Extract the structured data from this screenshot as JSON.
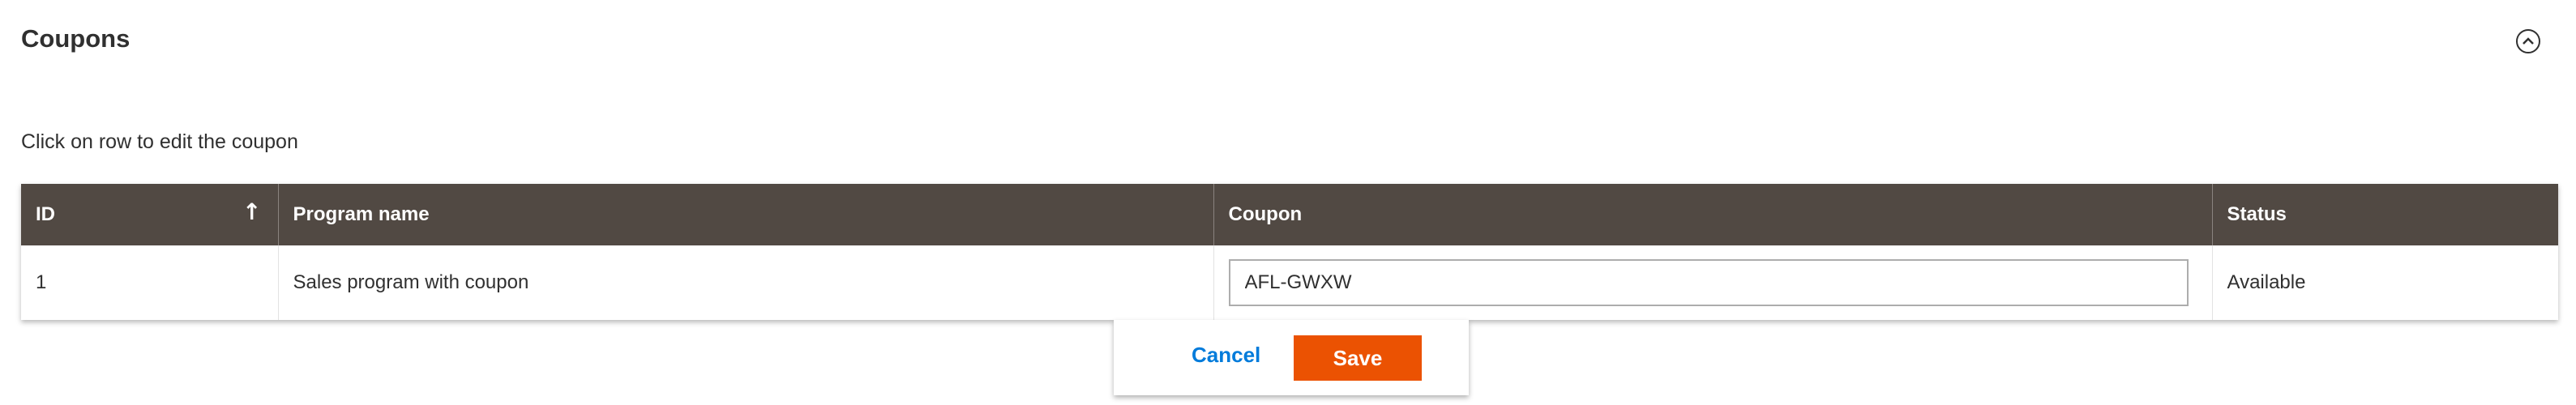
{
  "section": {
    "title": "Coupons",
    "hint": "Click on row to edit the coupon"
  },
  "table": {
    "columns": {
      "id": "ID",
      "program_name": "Program name",
      "coupon": "Coupon",
      "status": "Status"
    },
    "sort_indicator": "↑",
    "rows": [
      {
        "id": "1",
        "program_name": "Sales program with coupon",
        "coupon": "AFL-GWXW",
        "status": "Available"
      }
    ]
  },
  "actions": {
    "cancel_label": "Cancel",
    "save_label": "Save"
  },
  "colors": {
    "header_bg": "#514943",
    "save_bg": "#eb5202",
    "link": "#007bdb"
  }
}
